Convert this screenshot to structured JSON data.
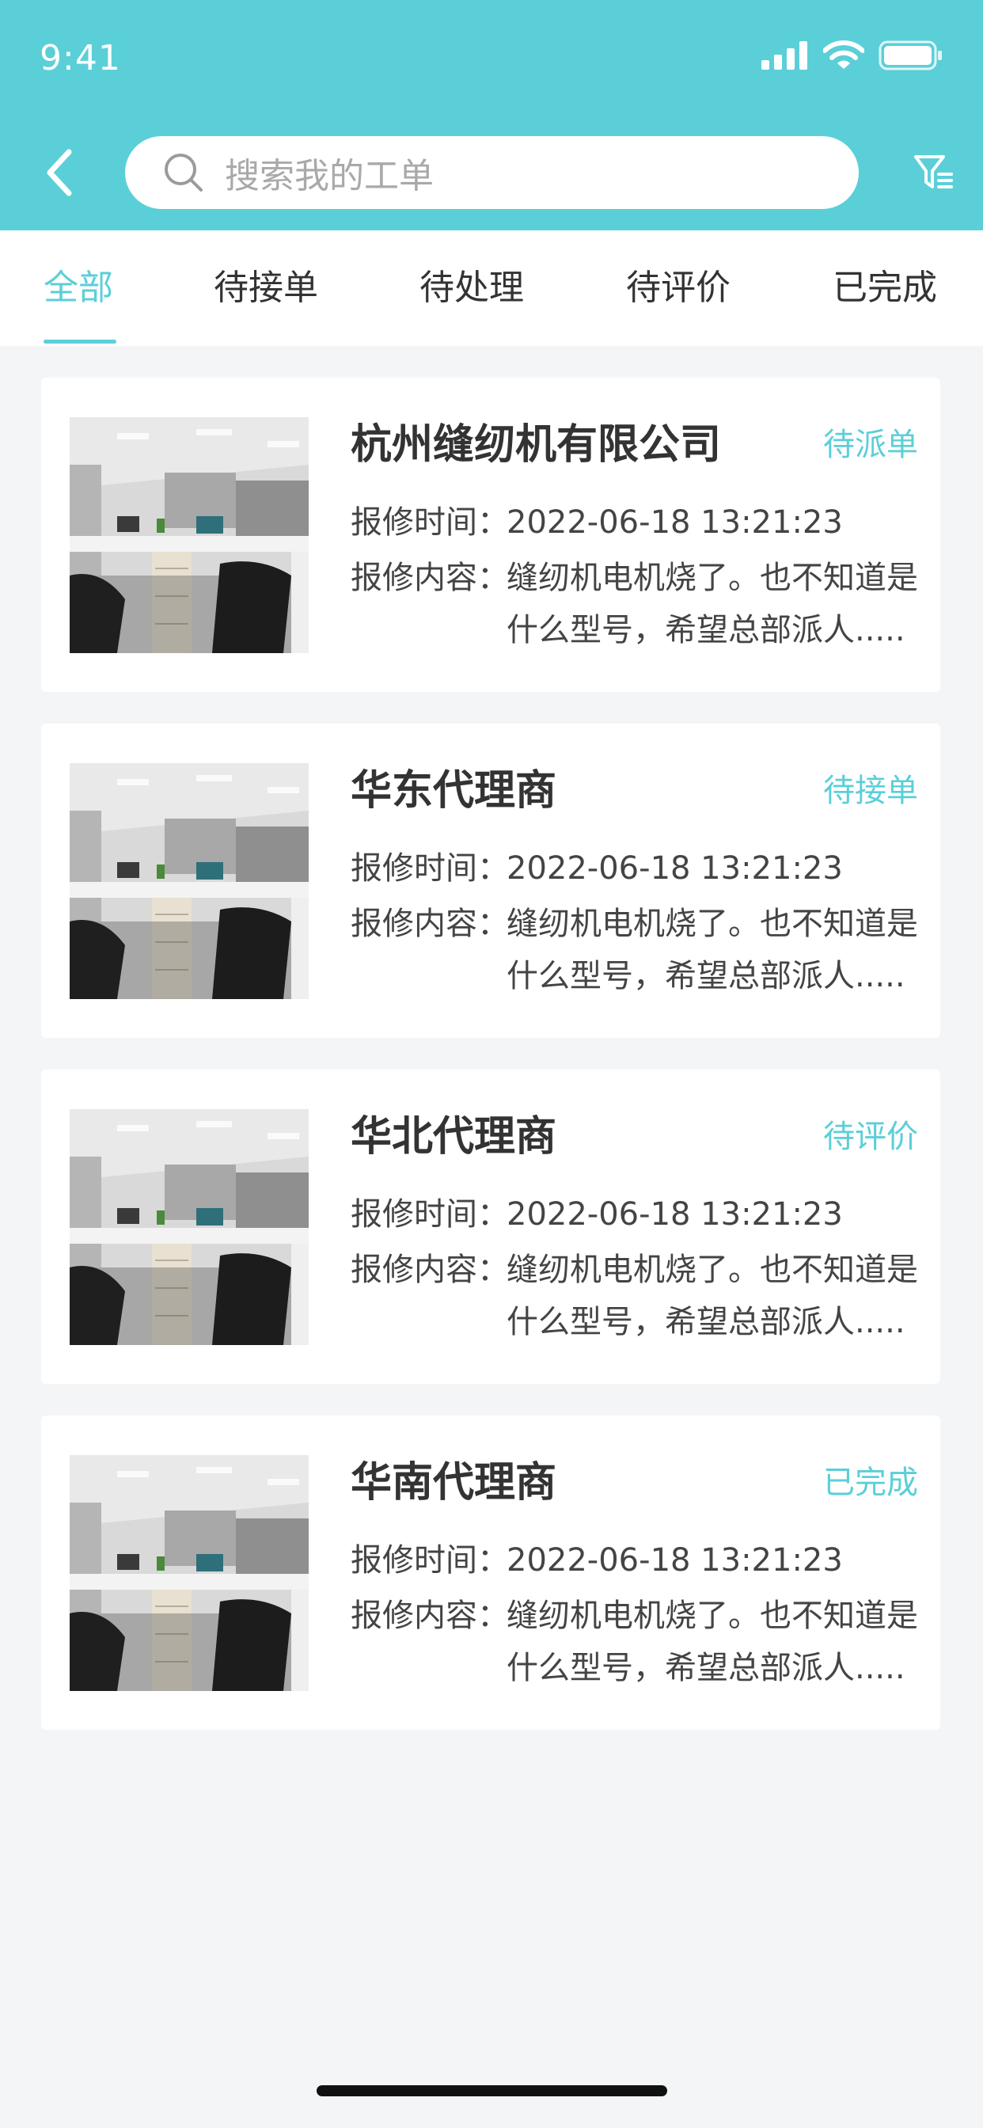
{
  "status_bar": {
    "time": "9:41"
  },
  "header": {
    "search_placeholder": "搜索我的工单",
    "accent_color": "#5bcfd8"
  },
  "tabs": [
    {
      "label": "全部",
      "active": true
    },
    {
      "label": "待接单",
      "active": false
    },
    {
      "label": "待处理",
      "active": false
    },
    {
      "label": "待评价",
      "active": false
    },
    {
      "label": "已完成",
      "active": false
    }
  ],
  "orders": [
    {
      "company": "杭州缝纫机有限公司",
      "status": "待派单",
      "time_label": "报修时间：",
      "time_value": "2022-06-18  13:21:23",
      "content_label": "报修内容：",
      "content_line1": "缝纫机电机烧了。也不知道是",
      "content_line2": "什么型号，希望总部派人....."
    },
    {
      "company": "华东代理商",
      "status": "待接单",
      "time_label": "报修时间：",
      "time_value": "2022-06-18  13:21:23",
      "content_label": "报修内容：",
      "content_line1": "缝纫机电机烧了。也不知道是",
      "content_line2": "什么型号，希望总部派人....."
    },
    {
      "company": "华北代理商",
      "status": "待评价",
      "time_label": "报修时间：",
      "time_value": "2022-06-18  13:21:23",
      "content_label": "报修内容：",
      "content_line1": "缝纫机电机烧了。也不知道是",
      "content_line2": "什么型号，希望总部派人....."
    },
    {
      "company": "华南代理商",
      "status": "已完成",
      "time_label": "报修时间：",
      "time_value": "2022-06-18  13:21:23",
      "content_label": "报修内容：",
      "content_line1": "缝纫机电机烧了。也不知道是",
      "content_line2": "什么型号，希望总部派人....."
    }
  ]
}
